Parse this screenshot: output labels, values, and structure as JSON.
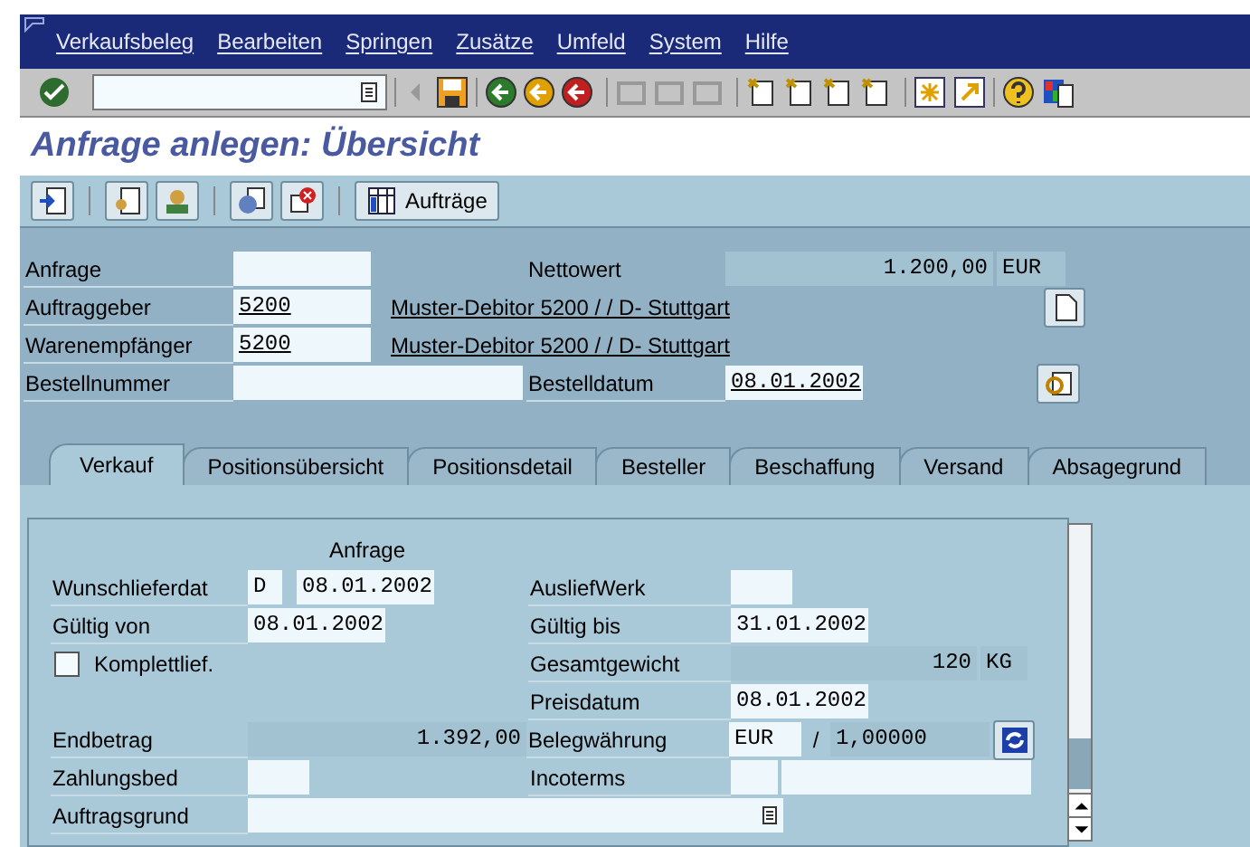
{
  "menu": [
    "Verkaufsbeleg",
    "Bearbeiten",
    "Springen",
    "Zusätze",
    "Umfeld",
    "System",
    "Hilfe"
  ],
  "title": "Anfrage anlegen: Übersicht",
  "app_toolbar": {
    "button": "Aufträge"
  },
  "header": {
    "anfrage": {
      "label": "Anfrage"
    },
    "nettowert": {
      "label": "Nettowert",
      "value": "1.200,00",
      "currency": "EUR"
    },
    "auftraggeber": {
      "label": "Auftraggeber",
      "value": "5200",
      "link": "Muster-Debitor 5200 / / D- Stuttgart"
    },
    "warenempfaenger": {
      "label": "Warenempfänger",
      "value": "5200",
      "link": "Muster-Debitor 5200 / / D- Stuttgart"
    },
    "bestellnummer": {
      "label": "Bestellnummer"
    },
    "bestelldatum": {
      "label": "Bestelldatum",
      "value": "08.01.2002"
    }
  },
  "tabs": [
    {
      "label": "Verkauf",
      "selected": true
    },
    {
      "label": "Positionsübersicht",
      "selected": false
    },
    {
      "label": "Positionsdetail",
      "selected": false
    },
    {
      "label": "Besteller",
      "selected": false
    },
    {
      "label": "Beschaffung",
      "selected": false
    },
    {
      "label": "Versand",
      "selected": false
    },
    {
      "label": "Absagegrund",
      "selected": false
    }
  ],
  "panel": {
    "heading": "Anfrage",
    "wunschlieferdat": {
      "label": "Wunschlieferdat",
      "type": "D",
      "value": "08.01.2002"
    },
    "ausliefwerk": {
      "label": "AusliefWerk"
    },
    "gueltig_von": {
      "label": "Gültig von",
      "value": "08.01.2002"
    },
    "gueltig_bis": {
      "label": "Gültig bis",
      "value": "31.01.2002"
    },
    "komplettlief": {
      "label": "Komplettlief.",
      "checked": false
    },
    "gesamtgewicht": {
      "label": "Gesamtgewicht",
      "value": "120",
      "unit": "KG"
    },
    "preisdatum": {
      "label": "Preisdatum",
      "value": "08.01.2002"
    },
    "endbetrag": {
      "label": "Endbetrag",
      "value": "1.392,00"
    },
    "belegwaehrung": {
      "label": "Belegwährung",
      "currency": "EUR",
      "separator": "/",
      "rate": "1,00000"
    },
    "zahlungsbed": {
      "label": "Zahlungsbed"
    },
    "incoterms": {
      "label": "Incoterms"
    },
    "auftragsgrund": {
      "label": "Auftragsgrund"
    }
  }
}
